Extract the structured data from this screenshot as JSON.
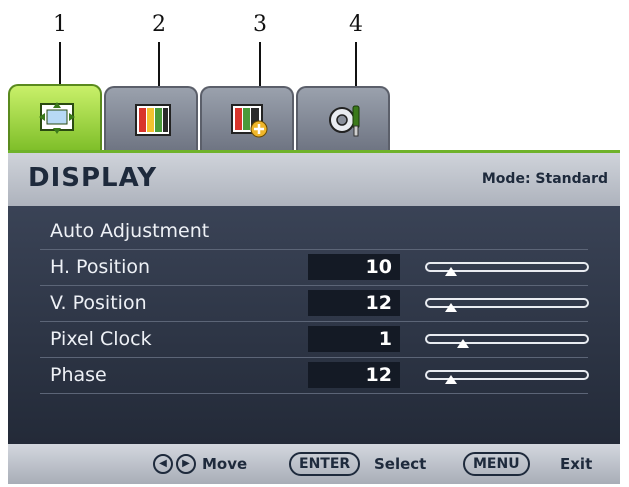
{
  "callouts": [
    "1",
    "2",
    "3",
    "4"
  ],
  "tabs": [
    {
      "icon": "display-arrows-icon",
      "active": true
    },
    {
      "icon": "picture-icon",
      "active": false
    },
    {
      "icon": "picture-advanced-icon",
      "active": false
    },
    {
      "icon": "system-settings-icon",
      "active": false
    }
  ],
  "menu": {
    "title": "DISPLAY",
    "mode": "Mode: Standard",
    "items": [
      {
        "label": "Auto Adjustment"
      },
      {
        "label": "H. Position",
        "value": "10",
        "slider": 0.12
      },
      {
        "label": "V. Position",
        "value": "12",
        "slider": 0.12
      },
      {
        "label": "Pixel Clock",
        "value": "1",
        "slider": 0.2
      },
      {
        "label": "Phase",
        "value": "12",
        "slider": 0.12
      }
    ]
  },
  "footer": {
    "move_label": "Move",
    "enter_key": "ENTER",
    "select_label": "Select",
    "menu_key": "MENU",
    "exit_label": "Exit"
  },
  "colors": {
    "active_tab": "#9bd83c",
    "menu_body": "#2e3546",
    "menu_bar": "#bfc3cb"
  }
}
